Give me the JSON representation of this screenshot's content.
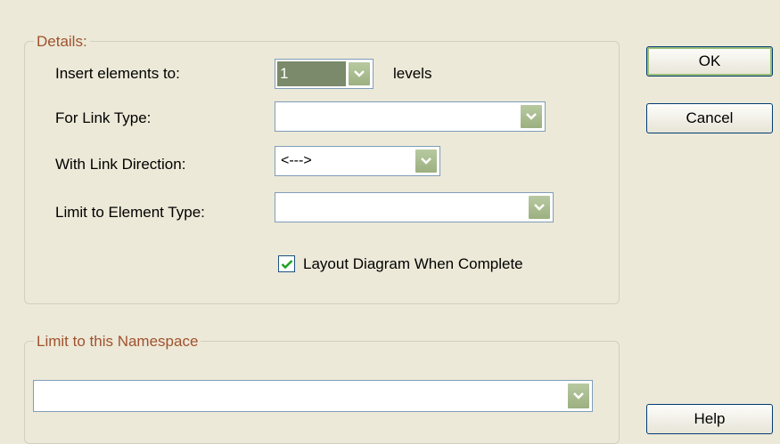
{
  "details": {
    "legend": "Details:",
    "insert_label": "Insert elements to:",
    "insert_value": "1",
    "levels_label": "levels",
    "link_type_label": "For Link Type:",
    "link_type_value": "",
    "link_direction_label": "With Link Direction:",
    "link_direction_value": "<--->",
    "element_type_label": "Limit to Element Type:",
    "element_type_value": "",
    "layout_checkbox_label": "Layout Diagram When Complete",
    "layout_checked": true
  },
  "namespace": {
    "legend": "Limit to this Namespace",
    "value": ""
  },
  "buttons": {
    "ok": "OK",
    "cancel": "Cancel",
    "help": "Help"
  },
  "icons": {
    "dropdown": "chevron-down-icon",
    "check": "checkmark-icon"
  },
  "colors": {
    "dialog_bg": "#ece9d8",
    "legend_text": "#a0522d",
    "dropdown_button": "#9cb080"
  }
}
